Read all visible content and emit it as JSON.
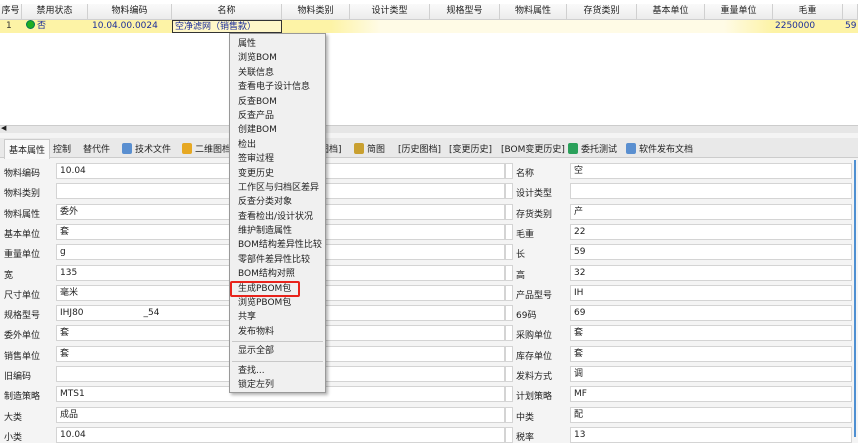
{
  "grid": {
    "headers": [
      "序号",
      "禁用状态",
      "物料编码",
      "名称",
      "物料类别",
      "设计类型",
      "规格型号",
      "物料属性",
      "存货类别",
      "基本单位",
      "重量单位",
      "毛重"
    ],
    "row": {
      "index": "1",
      "disabled": "否",
      "code": "10.04.00.0024",
      "name": "空净滤网（销售款）",
      "weight": "2250000",
      "extra": "59"
    }
  },
  "tabs": [
    "基本属性",
    "控制",
    "替代件",
    "技术文件",
    "二维图档",
    "图档]",
    "简图",
    "[历史图档]",
    "[变更历史]",
    "[BOM变更历史]",
    "委托测试",
    "软件发布文档"
  ],
  "form": {
    "left": [
      [
        "物料编码",
        "10.04"
      ],
      [
        "物料类别",
        ""
      ],
      [
        "物料属性",
        "委外"
      ],
      [
        "基本单位",
        "套"
      ],
      [
        "重量单位",
        "g"
      ],
      [
        "宽",
        "135"
      ],
      [
        "尺寸单位",
        "毫米"
      ],
      [
        "规格型号",
        "IHJ80"
      ],
      [
        "委外单位",
        "套"
      ],
      [
        "销售单位",
        "套"
      ],
      [
        "旧编码",
        ""
      ],
      [
        "制造策略",
        "MTS1"
      ],
      [
        "大类",
        "成品"
      ],
      [
        "小类",
        "10.04"
      ]
    ],
    "right": [
      [
        "名称",
        "空"
      ],
      [
        "设计类型",
        ""
      ],
      [
        "存货类别",
        "产"
      ],
      [
        "毛重",
        "22"
      ],
      [
        "长",
        "59"
      ],
      [
        "高",
        "32"
      ],
      [
        "产品型号",
        "IH"
      ],
      [
        "69码",
        "69"
      ],
      [
        "采购单位",
        "套"
      ],
      [
        "库存单位",
        "套"
      ],
      [
        "发料方式",
        "调"
      ],
      [
        "计划策略",
        "MF"
      ],
      [
        "中类",
        "配"
      ],
      [
        "税率",
        "13"
      ]
    ],
    "spec_suffix": "_54"
  },
  "menu": {
    "group1": [
      "属性",
      "浏览BOM",
      "关联信息",
      "查看电子设计信息",
      "反查BOM",
      "反查产品",
      "创建BOM",
      "检出",
      "签审过程",
      "变更历史",
      "工作区与归档区差异",
      "反查分类对象",
      "查看检出/设计状况",
      "维护制造属性",
      "BOM结构差异性比较",
      "零部件差异性比较",
      "BOM结构对照",
      "生成PBOM包",
      "浏览PBOM包",
      "共享",
      "发布物料"
    ],
    "group2": [
      "显示全部"
    ],
    "group3": [
      "查找...",
      "锁定左列"
    ],
    "highlighted": "生成PBOM包"
  },
  "colors": {
    "row_highlight": "#fdf3a6",
    "highlight_box": "#e8231b",
    "link": "#1c2e9a"
  }
}
